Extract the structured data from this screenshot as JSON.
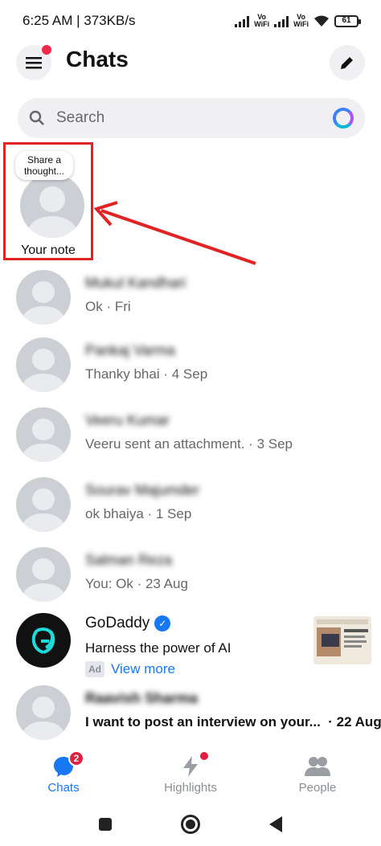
{
  "status_bar": {
    "time_speed": "6:25 AM | 373KB/s",
    "vowifi_1": [
      "Vo",
      "WiFi"
    ],
    "vowifi_2": [
      "Vo",
      "WiFi"
    ],
    "battery": "61"
  },
  "header": {
    "title": "Chats",
    "menu_icon": "hamburger-icon",
    "edit_icon": "pencil-icon"
  },
  "search": {
    "placeholder": "Search",
    "icon": "search-icon",
    "ai_icon": "meta-ai-icon"
  },
  "note": {
    "bubble_line1": "Share a",
    "bubble_line2": "thought...",
    "label": "Your note"
  },
  "chats": [
    {
      "name": "Mukul Kandhari",
      "preview": "Ok · Fri",
      "unread": false
    },
    {
      "name": "Pankaj Varma",
      "preview": "Thanky bhai · 4 Sep",
      "unread": false
    },
    {
      "name": "Veeru Kumar",
      "preview": "Veeru sent an attachment. · 3 Sep",
      "unread": false
    },
    {
      "name": "Sourav Majumder",
      "preview": "ok bhaiya · 1 Sep",
      "unread": false
    },
    {
      "name": "Salman Reza",
      "preview": "You: Ok · 23 Aug",
      "unread": false
    }
  ],
  "ad": {
    "name": "GoDaddy",
    "text": "Harness the power of AI",
    "badge": "Ad",
    "link": "View more"
  },
  "last_chat": {
    "name": "Raavish Sharma",
    "preview": "I want to post an interview on your...",
    "time": "· 22 Aug"
  },
  "bottom_nav": {
    "chats_label": "Chats",
    "chats_badge": "2",
    "highlights_label": "Highlights",
    "people_label": "People"
  },
  "colors": {
    "accent": "#1877f2",
    "highlight_box": "#e02424",
    "badge": "#e41e3f"
  }
}
